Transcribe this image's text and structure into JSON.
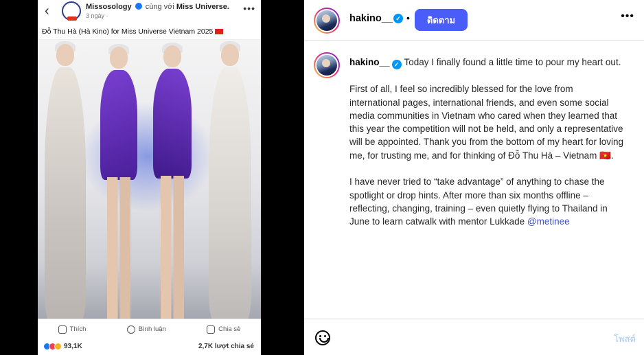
{
  "media": {
    "fb_post": {
      "page_name": "Missosology",
      "with_text": "cùng với",
      "partner": "Miss Universe.",
      "time": "3 ngày ·",
      "caption": "Đỗ Thu Hà (Hà Kino) for Miss Universe Vietnam 2025",
      "actions": {
        "like": "Thích",
        "comment": "Bình luận",
        "share": "Chia sẻ"
      },
      "reaction_count": "93,1K",
      "share_count": "2,7K lượt chia sẻ"
    }
  },
  "header": {
    "username": "hakino__",
    "separator": "•",
    "follow_label": "ติดตาม",
    "more_label": "•••"
  },
  "caption": {
    "username": "hakino__",
    "p1": "Today I finally found a little time to pour my heart out.",
    "p2": "First of all, I feel so incredibly blessed for the love from international pages, international friends, and even some social media communities in Vietnam who cared when they learned that this year the competition will not be held, and only a representative will be appointed. Thank you from the bottom of my heart for loving me, for trusting me, and for thinking of Đỗ Thu Hà – Vietnam 🇻🇳.",
    "p3": "I have never tried to “take advantage” of anything to chase the spotlight or drop hints. After more than six months offline – reflecting, changing, training – even quietly flying to Thailand in June to learn catwalk with mentor Lukkade",
    "mention": "@metinee"
  },
  "footer": {
    "comment_placeholder": "",
    "post_label": "โพสต์"
  },
  "colors": {
    "follow_button": "#4a5df9",
    "verified": "#0095f6",
    "fb_verified": "#1877f2"
  }
}
